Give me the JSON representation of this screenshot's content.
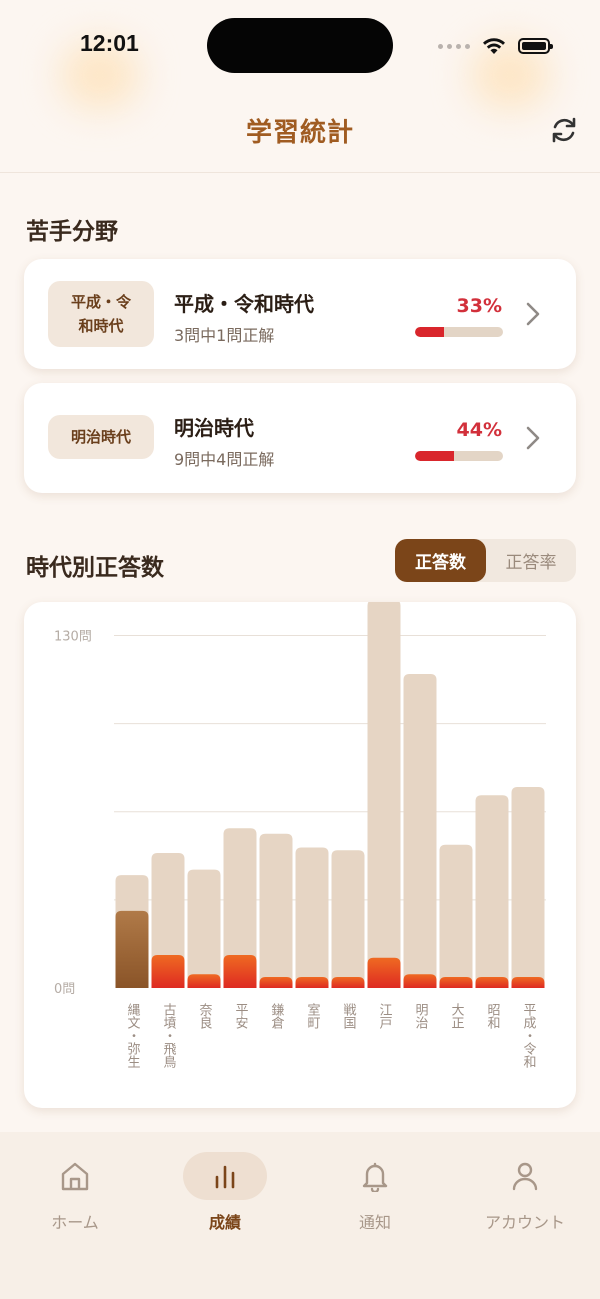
{
  "status": {
    "time": "12:01"
  },
  "header": {
    "title": "学習統計"
  },
  "weak_section": {
    "title": "苦手分野",
    "items": [
      {
        "tag": "平成・令\n和時代",
        "name": "平成・令和時代",
        "detail": "3問中1問正解",
        "percent_label": "33%",
        "percent": 33
      },
      {
        "tag": "明治時代",
        "name": "明治時代",
        "detail": "9問中4問正解",
        "percent_label": "44%",
        "percent": 44
      }
    ]
  },
  "chart_section": {
    "title": "時代別正答数",
    "toggle": {
      "options": [
        "正答数",
        "正答率"
      ],
      "selected": "正答数"
    }
  },
  "chart_data": {
    "type": "bar",
    "categories": [
      "縄文・弥生",
      "古墳・飛鳥",
      "奈良",
      "平安",
      "鎌倉",
      "室町",
      "戦国",
      "江戸",
      "明治",
      "大正",
      "昭和",
      "平成・令和"
    ],
    "series": [
      {
        "values": [
          41,
          49,
          43,
          58,
          56,
          51,
          50,
          141,
          114,
          52,
          70,
          73
        ]
      },
      {
        "values": [
          28,
          12,
          5,
          12,
          4,
          4,
          4,
          11,
          5,
          4,
          4,
          4
        ]
      }
    ],
    "ylim": [
      0,
      130
    ],
    "yticks": [
      0,
      32,
      64,
      96,
      128
    ],
    "ytick_labels": [
      "0問",
      "",
      "",
      "",
      "130問"
    ],
    "grid": true,
    "colors": {
      "total": "#e6d5c4",
      "correct_highlight": "#a36b3c",
      "correct": "#e23b22"
    }
  },
  "tab_bar": {
    "items": [
      {
        "label": "ホーム",
        "icon": "home-icon",
        "active": false
      },
      {
        "label": "成績",
        "icon": "bar-chart-icon",
        "active": true
      },
      {
        "label": "通知",
        "icon": "bell-icon",
        "active": false
      },
      {
        "label": "アカウント",
        "icon": "person-icon",
        "active": false
      }
    ]
  }
}
